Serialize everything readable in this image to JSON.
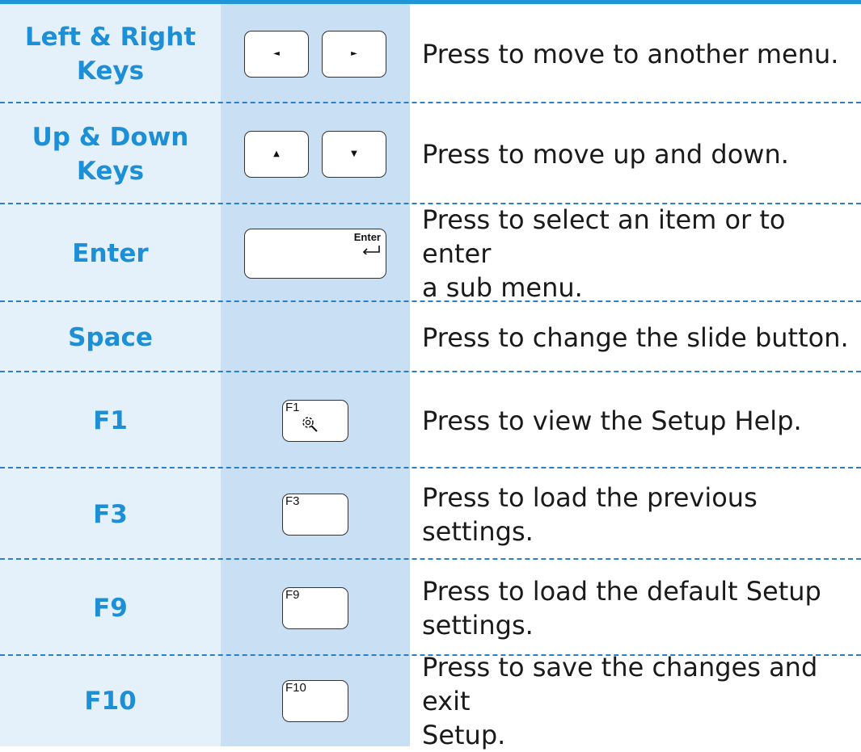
{
  "rows": [
    {
      "name": "Left & Right Keys",
      "name_lines": [
        "Left & Right",
        "Keys"
      ],
      "desc_lines": [
        "Press to move to another menu."
      ],
      "keys": [
        {
          "glyph": "◄",
          "icon": "left-arrow-icon"
        },
        {
          "glyph": "►",
          "icon": "right-arrow-icon"
        }
      ]
    },
    {
      "name": "Up & Down Keys",
      "name_lines": [
        "Up & Down",
        "Keys"
      ],
      "desc_lines": [
        "Press to move up and down."
      ],
      "keys": [
        {
          "glyph": "▲",
          "icon": "up-arrow-icon"
        },
        {
          "glyph": "▼",
          "icon": "down-arrow-icon"
        }
      ]
    },
    {
      "name": "Enter",
      "name_lines": [
        "Enter"
      ],
      "desc_lines": [
        "Press to select an item or to enter",
        "a sub menu."
      ],
      "keys": [
        {
          "label": "Enter",
          "icon": "enter-return-icon"
        }
      ]
    },
    {
      "name": "Space",
      "name_lines": [
        "Space"
      ],
      "desc_lines": [
        "Press to change the slide button."
      ],
      "keys": []
    },
    {
      "name": "F1",
      "name_lines": [
        "F1"
      ],
      "desc_lines": [
        "Press to view the Setup Help."
      ],
      "keys": [
        {
          "label": "F1",
          "icon": "settings-help-icon"
        }
      ]
    },
    {
      "name": "F3",
      "name_lines": [
        "F3"
      ],
      "desc_lines": [
        "Press to load the previous settings."
      ],
      "keys": [
        {
          "label": "F3"
        }
      ]
    },
    {
      "name": "F9",
      "name_lines": [
        "F9"
      ],
      "desc_lines": [
        "Press to load the default Setup",
        "settings."
      ],
      "keys": [
        {
          "label": "F9"
        }
      ]
    },
    {
      "name": "F10",
      "name_lines": [
        "F10"
      ],
      "desc_lines": [
        "Press to save the changes and exit",
        "Setup."
      ],
      "keys": [
        {
          "label": "F10"
        }
      ]
    }
  ],
  "colors": {
    "accent": "#1d8fd6",
    "top_rule": "#2096d8",
    "name_bg": "#e5f1fa",
    "key_bg": "#c9e0f4",
    "divider": "#2a7fc8"
  }
}
